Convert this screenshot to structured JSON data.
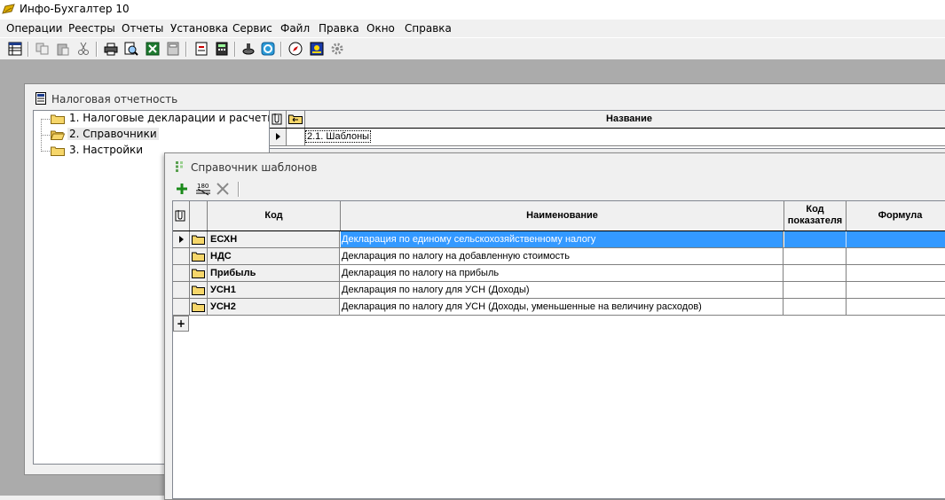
{
  "app": {
    "title": "Инфо-Бухгалтер 10"
  },
  "menu": [
    "Операции",
    "Реестры",
    "Отчеты",
    "Установка",
    "Сервис",
    "Файл",
    "Правка",
    "Окно",
    "Справка"
  ],
  "toolbar_icons": [
    "table-icon",
    "copy-icon",
    "paste-icon",
    "cut-icon",
    "print-icon",
    "preview-icon",
    "excel-icon",
    "calculator-icon",
    "document-icon",
    "calc2-icon",
    "stamp-icon",
    "refresh-icon",
    "compass-icon",
    "image-icon",
    "settings-icon"
  ],
  "tax_window": {
    "title": "Налоговая отчетность",
    "tree": [
      {
        "label": "1. Налоговые декларации и расчеты",
        "selected": false
      },
      {
        "label": "2. Справочники",
        "selected": true
      },
      {
        "label": "3. Настройки",
        "selected": false
      }
    ],
    "grid": {
      "header_name": "Название",
      "rows": [
        {
          "name": "2.1. Шаблоны"
        }
      ]
    }
  },
  "templates_window": {
    "title": "Справочник шаблонов",
    "tools": [
      "add-icon",
      "numbering-icon",
      "delete-icon"
    ],
    "columns": {
      "kod": "Код",
      "name": "Наименование",
      "kod_pok_1": "Код",
      "kod_pok_2": "показателя",
      "formula": "Формула"
    },
    "rows": [
      {
        "kod": "ЕСХН",
        "name": "Декларация по единому сельскохозяйственному налогу",
        "selected": true
      },
      {
        "kod": "НДС",
        "name": "Декларация по налогу на добавленную стоимость",
        "selected": false
      },
      {
        "kod": "Прибыль",
        "name": "Декларация по налогу на прибыль",
        "selected": false
      },
      {
        "kod": "УСН1",
        "name": "Декларация по налогу для УСН (Доходы)",
        "selected": false
      },
      {
        "kod": "УСН2",
        "name": "Декларация по налогу для УСН (Доходы, уменьшенные на величину расходов)",
        "selected": false
      }
    ],
    "add_row_label": "+"
  }
}
